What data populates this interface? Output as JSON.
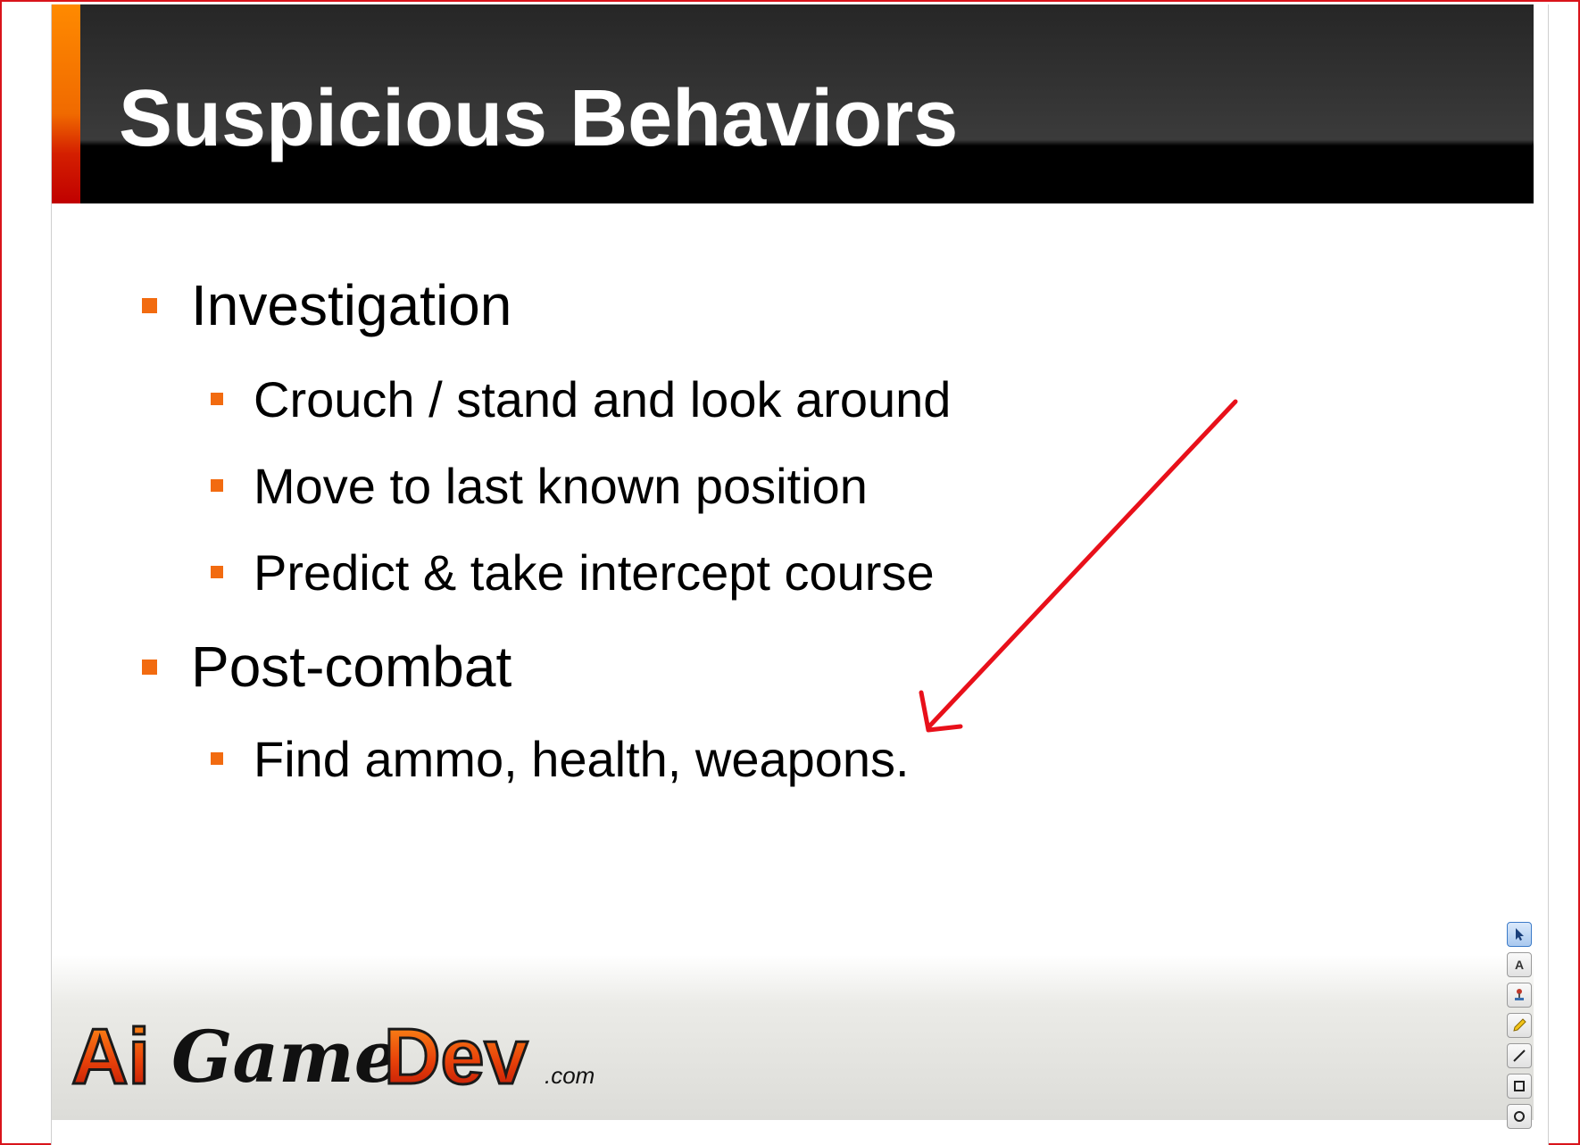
{
  "slide": {
    "title": "Suspicious Behaviors",
    "bullets": [
      {
        "level": 1,
        "text": "Investigation"
      },
      {
        "level": 2,
        "text": "Crouch / stand and look around"
      },
      {
        "level": 2,
        "text": "Move to last known position"
      },
      {
        "level": 2,
        "text": "Predict & take intercept course"
      },
      {
        "level": 1,
        "text": "Post-combat"
      },
      {
        "level": 2,
        "text": "Find ammo, health, weapons."
      }
    ]
  },
  "footer": {
    "logo_text": "AiGameDev",
    "logo_suffix": ".com"
  },
  "annotation_toolbar": {
    "tools": [
      "select-icon",
      "text-icon",
      "stamp-icon",
      "pencil-icon",
      "line-icon",
      "rectangle-icon",
      "ellipse-icon"
    ],
    "active_tool": "select-icon"
  },
  "colors": {
    "bullet_accent": "#f26b10",
    "frame_border": "#d9141b",
    "annotation_arrow": "#e8101a",
    "header_dark": "#2a2a2a"
  }
}
